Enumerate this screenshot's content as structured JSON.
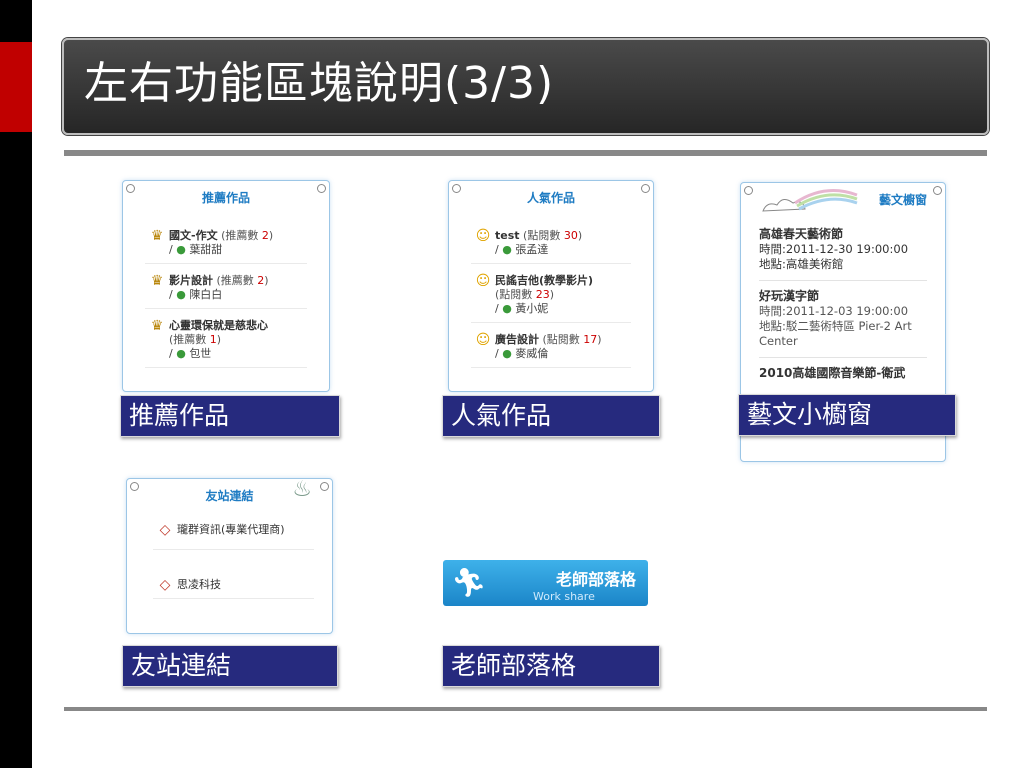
{
  "slide": {
    "title": "左右功能區塊說明(3/3)"
  },
  "widgets": {
    "recommended": {
      "title": "推薦作品",
      "items": [
        {
          "name": "國文-作文",
          "meta_label": "推薦數",
          "count": "2",
          "author": "葉甜甜"
        },
        {
          "name": "影片設計",
          "meta_label": "推薦數",
          "count": "2",
          "author": "陳白白"
        },
        {
          "name": "心靈環保就是慈悲心",
          "meta_label": "推薦數",
          "count": "1",
          "author": "包世"
        }
      ]
    },
    "popular": {
      "title": "人氣作品",
      "items": [
        {
          "name": "test",
          "meta_label": "點閱數",
          "count": "30",
          "author": "張孟達"
        },
        {
          "name": "民謠吉他(教學影片)",
          "meta_label": "點閱數",
          "count": "23",
          "author": "黃小妮"
        },
        {
          "name": "廣告設計",
          "meta_label": "點閱數",
          "count": "17",
          "author": "麥威倫"
        }
      ]
    },
    "art_window": {
      "title": "藝文櫥窗",
      "items": [
        {
          "title": "高雄春天藝術節",
          "time": "時間:2011-12-30 19:00:00",
          "place": "地點:高雄美術館"
        },
        {
          "title": "好玩漢字節",
          "time": "時間:2011-12-03 19:00:00",
          "place": "地點:駁二藝術特區 Pier-2 Art Center"
        },
        {
          "title": "2010高雄國際音樂節-衛武"
        }
      ]
    },
    "links": {
      "title": "友站連結",
      "items": [
        {
          "name": "瓏群資訊(專業代理商)"
        },
        {
          "name": "思凌科技"
        }
      ]
    },
    "blog": {
      "title": "老師部落格",
      "subtitle": "Work share"
    }
  },
  "captions": {
    "recommended": "推薦作品",
    "popular": "人氣作品",
    "art_window": "藝文小櫥窗",
    "links": "友站連結",
    "blog": "老師部落格"
  },
  "colors": {
    "accent_red": "#c00000",
    "caption_bg": "#262a7e",
    "widget_title": "#1f7cc3",
    "count_red": "#cc0000"
  }
}
